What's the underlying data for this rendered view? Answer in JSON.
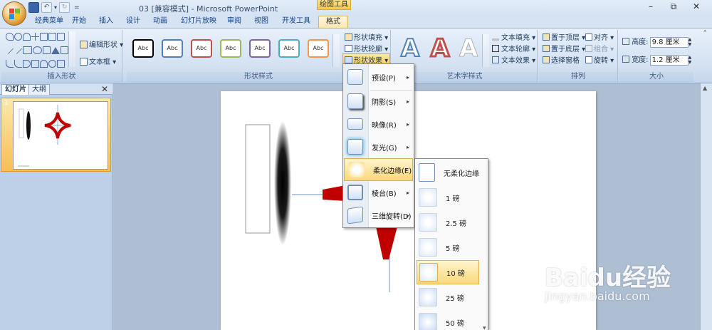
{
  "titlebar": {
    "title": "03 [兼容模式] - Microsoft PowerPoint",
    "contextual_tab_group": "绘图工具",
    "minimize": "–",
    "restore": "⧉",
    "close": "✕"
  },
  "qat": {
    "save_icon": "save-icon",
    "undo": "↶",
    "undo_arrow": "▾",
    "redo": "↻",
    "customize": "="
  },
  "tabs": [
    "经典菜单",
    "开始",
    "插入",
    "设计",
    "动画",
    "幻灯片放映",
    "审阅",
    "视图",
    "开发工具",
    "格式"
  ],
  "ribbon": {
    "insert_shapes": {
      "label": "插入形状",
      "edit_shape": "编辑形状",
      "text_box": "文本框"
    },
    "shape_styles": {
      "label": "形状样式",
      "swatch_text": "Abc",
      "swatch_colors": [
        "#000000",
        "#4f81bd",
        "#c0504d",
        "#9bbb59",
        "#8064a2",
        "#4bacc6",
        "#f79646"
      ],
      "fill": "形状填充",
      "outline": "形状轮廓",
      "effects": "形状效果"
    },
    "wordart": {
      "label": "艺术字样式",
      "glyph": "A",
      "text_fill": "文本填充",
      "text_outline": "文本轮廓",
      "text_effects": "文本效果"
    },
    "arrange": {
      "label": "排列",
      "bring_front": "置于顶层",
      "send_back": "置于底层",
      "selection_pane": "选择窗格",
      "align": "对齐",
      "group": "组合",
      "rotate": "旋转"
    },
    "size": {
      "label": "大小",
      "height_label": "高度:",
      "height_value": "9.8 厘米",
      "width_label": "宽度:",
      "width_value": "1.2 厘米"
    }
  },
  "left_pane": {
    "tabs": [
      "幻灯片",
      "大纲"
    ],
    "close": "✕",
    "slide_number": "1"
  },
  "effects_menu": {
    "items": [
      {
        "label": "预设(P)",
        "highlighted": false
      },
      {
        "label": "阴影(S)",
        "highlighted": false
      },
      {
        "label": "映像(R)",
        "highlighted": false
      },
      {
        "label": "发光(G)",
        "highlighted": false
      },
      {
        "label": "柔化边缘(E)",
        "highlighted": true
      },
      {
        "label": "棱台(B)",
        "highlighted": false
      },
      {
        "label": "三维旋转(D)",
        "highlighted": false
      }
    ],
    "arrow": "▸"
  },
  "soft_edges_menu": {
    "items": [
      {
        "label": "无柔化边缘",
        "highlighted": false
      },
      {
        "label": "1 磅",
        "highlighted": false
      },
      {
        "label": "2.5 磅",
        "highlighted": false
      },
      {
        "label": "5 磅",
        "highlighted": false
      },
      {
        "label": "10 磅",
        "highlighted": true
      },
      {
        "label": "25 磅",
        "highlighted": false
      },
      {
        "label": "50 磅",
        "highlighted": false
      }
    ]
  },
  "watermark": {
    "brand": "Baidu经验",
    "url": "jingyan.baidu.com"
  },
  "colors": {
    "accent_highlight": "#fbd97a",
    "shape_red": "#c00000"
  }
}
